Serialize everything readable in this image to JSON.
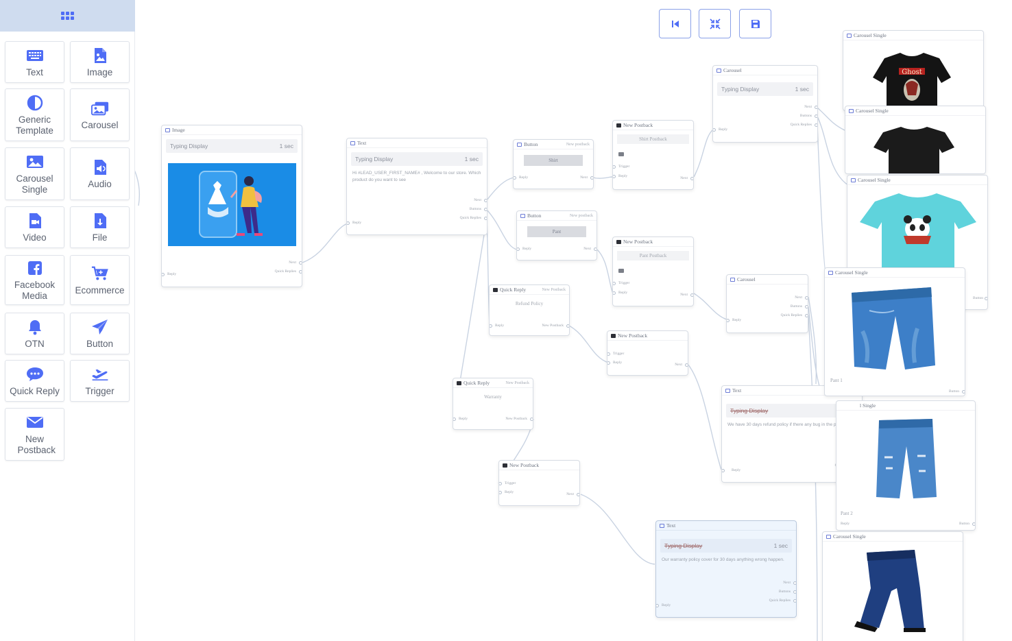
{
  "toolbox": {
    "items": [
      {
        "label": "Text",
        "icon": "keyboard-icon"
      },
      {
        "label": "Image",
        "icon": "image-file-icon"
      },
      {
        "label": "Generic Template",
        "icon": "contrast-icon"
      },
      {
        "label": "Carousel",
        "icon": "images-icon"
      },
      {
        "label": "Carousel Single",
        "icon": "image-icon"
      },
      {
        "label": "Audio",
        "icon": "audio-file-icon"
      },
      {
        "label": "Video",
        "icon": "video-file-icon"
      },
      {
        "label": "File",
        "icon": "download-file-icon"
      },
      {
        "label": "Facebook Media",
        "icon": "facebook-icon"
      },
      {
        "label": "Ecommerce",
        "icon": "cart-icon"
      },
      {
        "label": "OTN",
        "icon": "bell-icon"
      },
      {
        "label": "Button",
        "icon": "paper-plane-icon"
      },
      {
        "label": "Quick Reply",
        "icon": "chat-bubble-icon"
      },
      {
        "label": "Trigger",
        "icon": "plane-departure-icon"
      },
      {
        "label": "New Postback",
        "icon": "envelope-icon"
      }
    ]
  },
  "toolbar": {
    "first": "skip-back-icon",
    "fit": "compress-icon",
    "save": "save-icon"
  },
  "common": {
    "typing": "Typing Display",
    "sec": "1 sec",
    "next": "Next",
    "buttons": "Buttons",
    "quick_replies": "Quick Replies",
    "reply": "Reply",
    "trigger": "Trigger",
    "new_postback": "New Postback",
    "button": "Button",
    "new_postback_lc": "New postback",
    "new_postback_tc": "New Postback"
  },
  "nodes": {
    "image": {
      "title": "Image"
    },
    "text1": {
      "title": "Text",
      "message": "Hi #LEAD_USER_FIRST_NAME# , Welcome to our store. Which product do you want to see"
    },
    "button_shirt": {
      "title": "Button",
      "label": "Shirt"
    },
    "button_pant": {
      "title": "Button",
      "label": "Pant"
    },
    "np_shirt": {
      "title": "New Postback",
      "label": "Shirt Postback"
    },
    "np_pant": {
      "title": "New Postback",
      "label": "Pant Postback"
    },
    "qr_refund": {
      "title": "Quick Reply",
      "label": "Refund Policy"
    },
    "qr_warranty": {
      "title": "Quick Reply",
      "label": "Warranty"
    },
    "np_refund": {
      "title": "New Postback"
    },
    "np_warranty": {
      "title": "New Postback"
    },
    "carousel1": {
      "title": "Carousel"
    },
    "carousel2": {
      "title": "Carousel"
    },
    "text_refund": {
      "title": "Text",
      "message": "We have 30 days refund policy if there any bug in the product."
    },
    "text_warranty": {
      "title": "Text",
      "message": "Our warranty policy cover for 30 days anything wrong happen."
    },
    "cs1": {
      "title": "Carousel Single"
    },
    "cs2": {
      "title": "Carousel Single"
    },
    "cs3": {
      "title": "Carousel Single"
    },
    "cs4": {
      "title": "Carousel Single",
      "caption": "Pant 1",
      "button": "Button"
    },
    "cs5": {
      "title": "Carousel Single",
      "title_visible": "l Single",
      "caption": "Pant 2",
      "button": "Button"
    },
    "cs6": {
      "title": "Carousel Single"
    },
    "cs3_button": "Button"
  },
  "colors": {
    "accent": "#4f6df5",
    "sidebar_header": "#cfdcef",
    "image_bg": "#1a8ce6"
  }
}
